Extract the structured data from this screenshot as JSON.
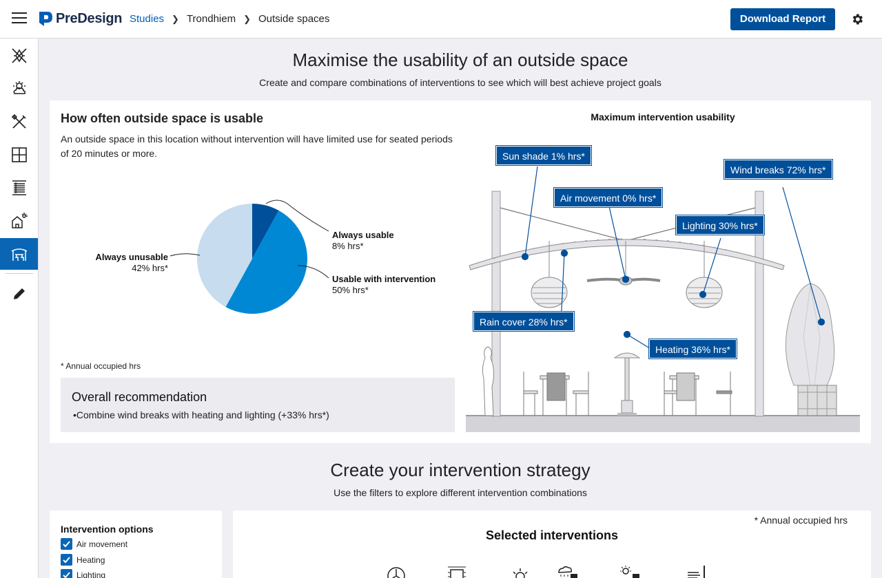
{
  "app": {
    "name": "PreDesign",
    "download_label": "Download Report",
    "breadcrumb": [
      "Studies",
      "Trondhiem",
      "Outside spaces"
    ]
  },
  "sidebar": {
    "items": [
      {
        "icon": "site-analysis-icon"
      },
      {
        "icon": "climate-icon"
      },
      {
        "icon": "tools-icon"
      },
      {
        "icon": "window-icon"
      },
      {
        "icon": "facade-icon"
      },
      {
        "icon": "house-solar-icon"
      },
      {
        "icon": "outside-spaces-icon",
        "active": true
      },
      {
        "icon": "edit-pencil-icon"
      }
    ]
  },
  "page": {
    "title": "Maximise the usability of an outside space",
    "subtitle": "Create and compare combinations of interventions to see which will best achieve project goals"
  },
  "usability": {
    "title": "How often outside space is usable",
    "description": "An outside space in this location without intervention will have limited use for seated periods of 20 minutes or more.",
    "annual_note": "* Annual occupied hrs",
    "recommendation_title": "Overall recommendation",
    "recommendation_item": "•Combine wind breaks with heating and lighting (+33% hrs*)"
  },
  "chart_data": {
    "type": "pie",
    "slices": [
      {
        "label": "Always usable",
        "value_label": "8% hrs*",
        "value": 8,
        "color": "#004f9a"
      },
      {
        "label": "Usable with intervention",
        "value_label": "50% hrs*",
        "value": 50,
        "color": "#0088d5"
      },
      {
        "label": "Always unusable",
        "value_label": "42% hrs*",
        "value": 42,
        "color": "#c7dcee"
      }
    ]
  },
  "illustration": {
    "title": "Maximum intervention usability",
    "tags": {
      "sun_shade": "Sun shade 1% hrs*",
      "air_movement": "Air movement 0% hrs*",
      "lighting": "Lighting 30% hrs*",
      "wind_breaks": "Wind breaks 72% hrs*",
      "rain_cover": "Rain cover 28% hrs*",
      "heating": "Heating 36% hrs*"
    }
  },
  "strategy": {
    "title": "Create your intervention strategy",
    "subtitle": "Use the filters to explore different intervention combinations",
    "options_title": "Intervention options",
    "options": [
      {
        "label": "Air movement",
        "checked": true
      },
      {
        "label": "Heating",
        "checked": true
      },
      {
        "label": "Lighting",
        "checked": true
      }
    ],
    "annual_note": "* Annual occupied hrs",
    "selected_title": "Selected interventions"
  },
  "colors": {
    "primary": "#004f9a",
    "accent": "#0088d5",
    "light": "#c7dcee"
  }
}
